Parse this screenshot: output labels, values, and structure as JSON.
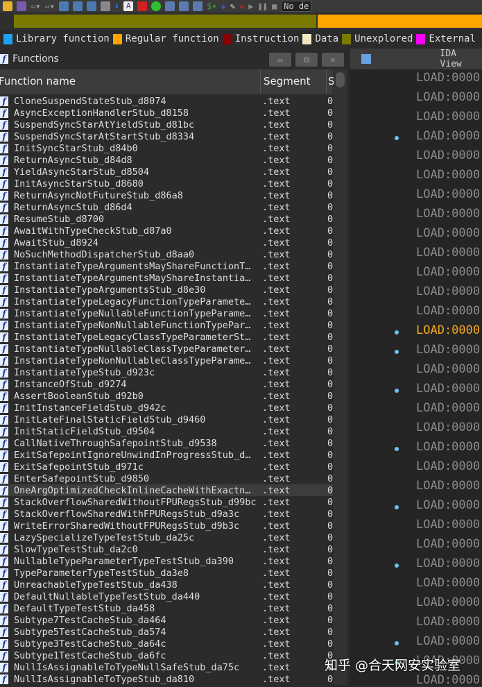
{
  "toolbar": {
    "debugger": "No de"
  },
  "legend": [
    {
      "label": "Library function",
      "color": "#1ea0f0"
    },
    {
      "label": "Regular function",
      "color": "#ffa500"
    },
    {
      "label": "Instruction",
      "color": "#8b0000"
    },
    {
      "label": "Data",
      "color": "#f0e8c0"
    },
    {
      "label": "Unexplored",
      "color": "#7a7a00"
    },
    {
      "label": "External",
      "color": "#ff00ff"
    }
  ],
  "functions_panel": {
    "title": "Functions",
    "columns": [
      "Function name",
      "Segment",
      "S"
    ],
    "rows": [
      "CloneSuspendStateStub_d8074",
      "AsyncExceptionHandlerStub_d8158",
      "SuspendSyncStarAtYieldStub_d81bc",
      "SuspendSyncStarAtStartStub_d8334",
      "InitSyncStarStub_d84b0",
      "ReturnAsyncStub_d84d8",
      "YieldAsyncStarStub_d8504",
      "InitAsyncStarStub_d8680",
      "ReturnAsyncNotFutureStub_d86a8",
      "ReturnAsyncStub_d86d4",
      "ResumeStub_d8700",
      "AwaitWithTypeCheckStub_d87a0",
      "AwaitStub_d8924",
      "NoSuchMethodDispatcherStub_d8aa0",
      "InstantiateTypeArgumentsMayShareFunctionT…",
      "InstantiateTypeArgumentsMayShareInstantia…",
      "InstantiateTypeArgumentsStub_d8e30",
      "InstantiateTypeLegacyFunctionTypeParamete…",
      "InstantiateTypeNullableFunctionTypeParame…",
      "InstantiateTypeNonNullableFunctionTypePar…",
      "InstantiateTypeLegacyClassTypeParameterSt…",
      "InstantiateTypeNullableClassTypeParameter…",
      "InstantiateTypeNonNullableClassTypeParame…",
      "InstantiateTypeStub_d923c",
      "InstanceOfStub_d9274",
      "AssertBooleanStub_d92b0",
      "InitInstanceFieldStub_d942c",
      "InitLateFinalStaticFieldStub_d9460",
      "InitStaticFieldStub_d9504",
      "CallNativeThroughSafepointStub_d9538",
      "ExitSafepointIgnoreUnwindInProgressStub_d…",
      "ExitSafepointStub_d971c",
      "EnterSafepointStub_d9850",
      "OneArgOptimizedCheckInlineCacheWithExactn…",
      "StackOverflowSharedWithoutFPURegsStub_d99bc",
      "StackOverflowSharedWithFPURegsStub_d9a3c",
      "WriteErrorSharedWithoutFPURegsStub_d9b3c",
      "LazySpecializeTypeTestStub_da25c",
      "SlowTypeTestStub_da2c0",
      "NullableTypeParameterTypeTestStub_da390",
      "TypeParameterTypeTestStub_da3e8",
      "UnreachableTypeTestStub_da438",
      "DefaultNullableTypeTestStub_da440",
      "DefaultTypeTestStub_da458",
      "Subtype7TestCacheStub_da464",
      "Subtype5TestCacheStub_da574",
      "Subtype3TestCacheStub_da64c",
      "Subtype1TestCacheStub_da6fc",
      "NullIsAssignableToTypeNullSafeStub_da75c",
      "NullIsAssignableToTypeStub_da810"
    ],
    "segment": ".text",
    "start": "0",
    "selected_index": 33
  },
  "ida_view": {
    "title": "IDA View",
    "line_prefix": "LOAD:0000",
    "highlighted_index": 13
  },
  "watermark": "知乎 @合天网安实验室"
}
